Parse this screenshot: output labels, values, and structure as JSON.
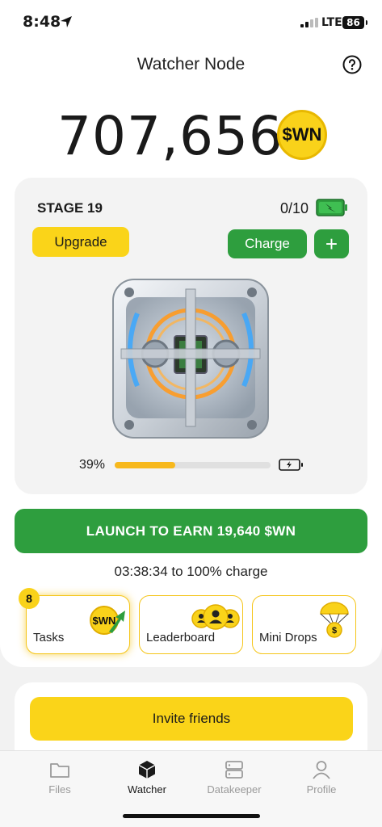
{
  "status_bar": {
    "time": "8:48",
    "network": "LTE",
    "battery": "86"
  },
  "header": {
    "title": "Watcher Node",
    "help_icon": "question-circle-icon"
  },
  "balance": {
    "amount": "707,656",
    "coin_label": "$WN"
  },
  "stage": {
    "label": "STAGE 19",
    "charges": "0/10",
    "upgrade_label": "Upgrade",
    "charge_label": "Charge",
    "add_label": "+",
    "progress_text": "39%",
    "progress": 0.39
  },
  "launch": {
    "label": "LAUNCH TO EARN 19,640 $WN"
  },
  "timer": {
    "text": "03:38:34 to 100% charge"
  },
  "features": {
    "tasks": {
      "label": "Tasks",
      "badge": "8",
      "coin_label": "$WN"
    },
    "leaderboard": {
      "label": "Leaderboard"
    },
    "mini_drops": {
      "label": "Mini Drops",
      "coin_label": "$"
    }
  },
  "invite": {
    "label": "Invite friends"
  },
  "tabs": [
    {
      "label": "Files",
      "icon": "folder-icon"
    },
    {
      "label": "Watcher",
      "icon": "cube-icon"
    },
    {
      "label": "Datakeeper",
      "icon": "server-icon"
    },
    {
      "label": "Profile",
      "icon": "person-icon"
    }
  ],
  "colors": {
    "green": "#2e9e3e",
    "yellow": "#fad419",
    "orange": "#f7b81c"
  }
}
